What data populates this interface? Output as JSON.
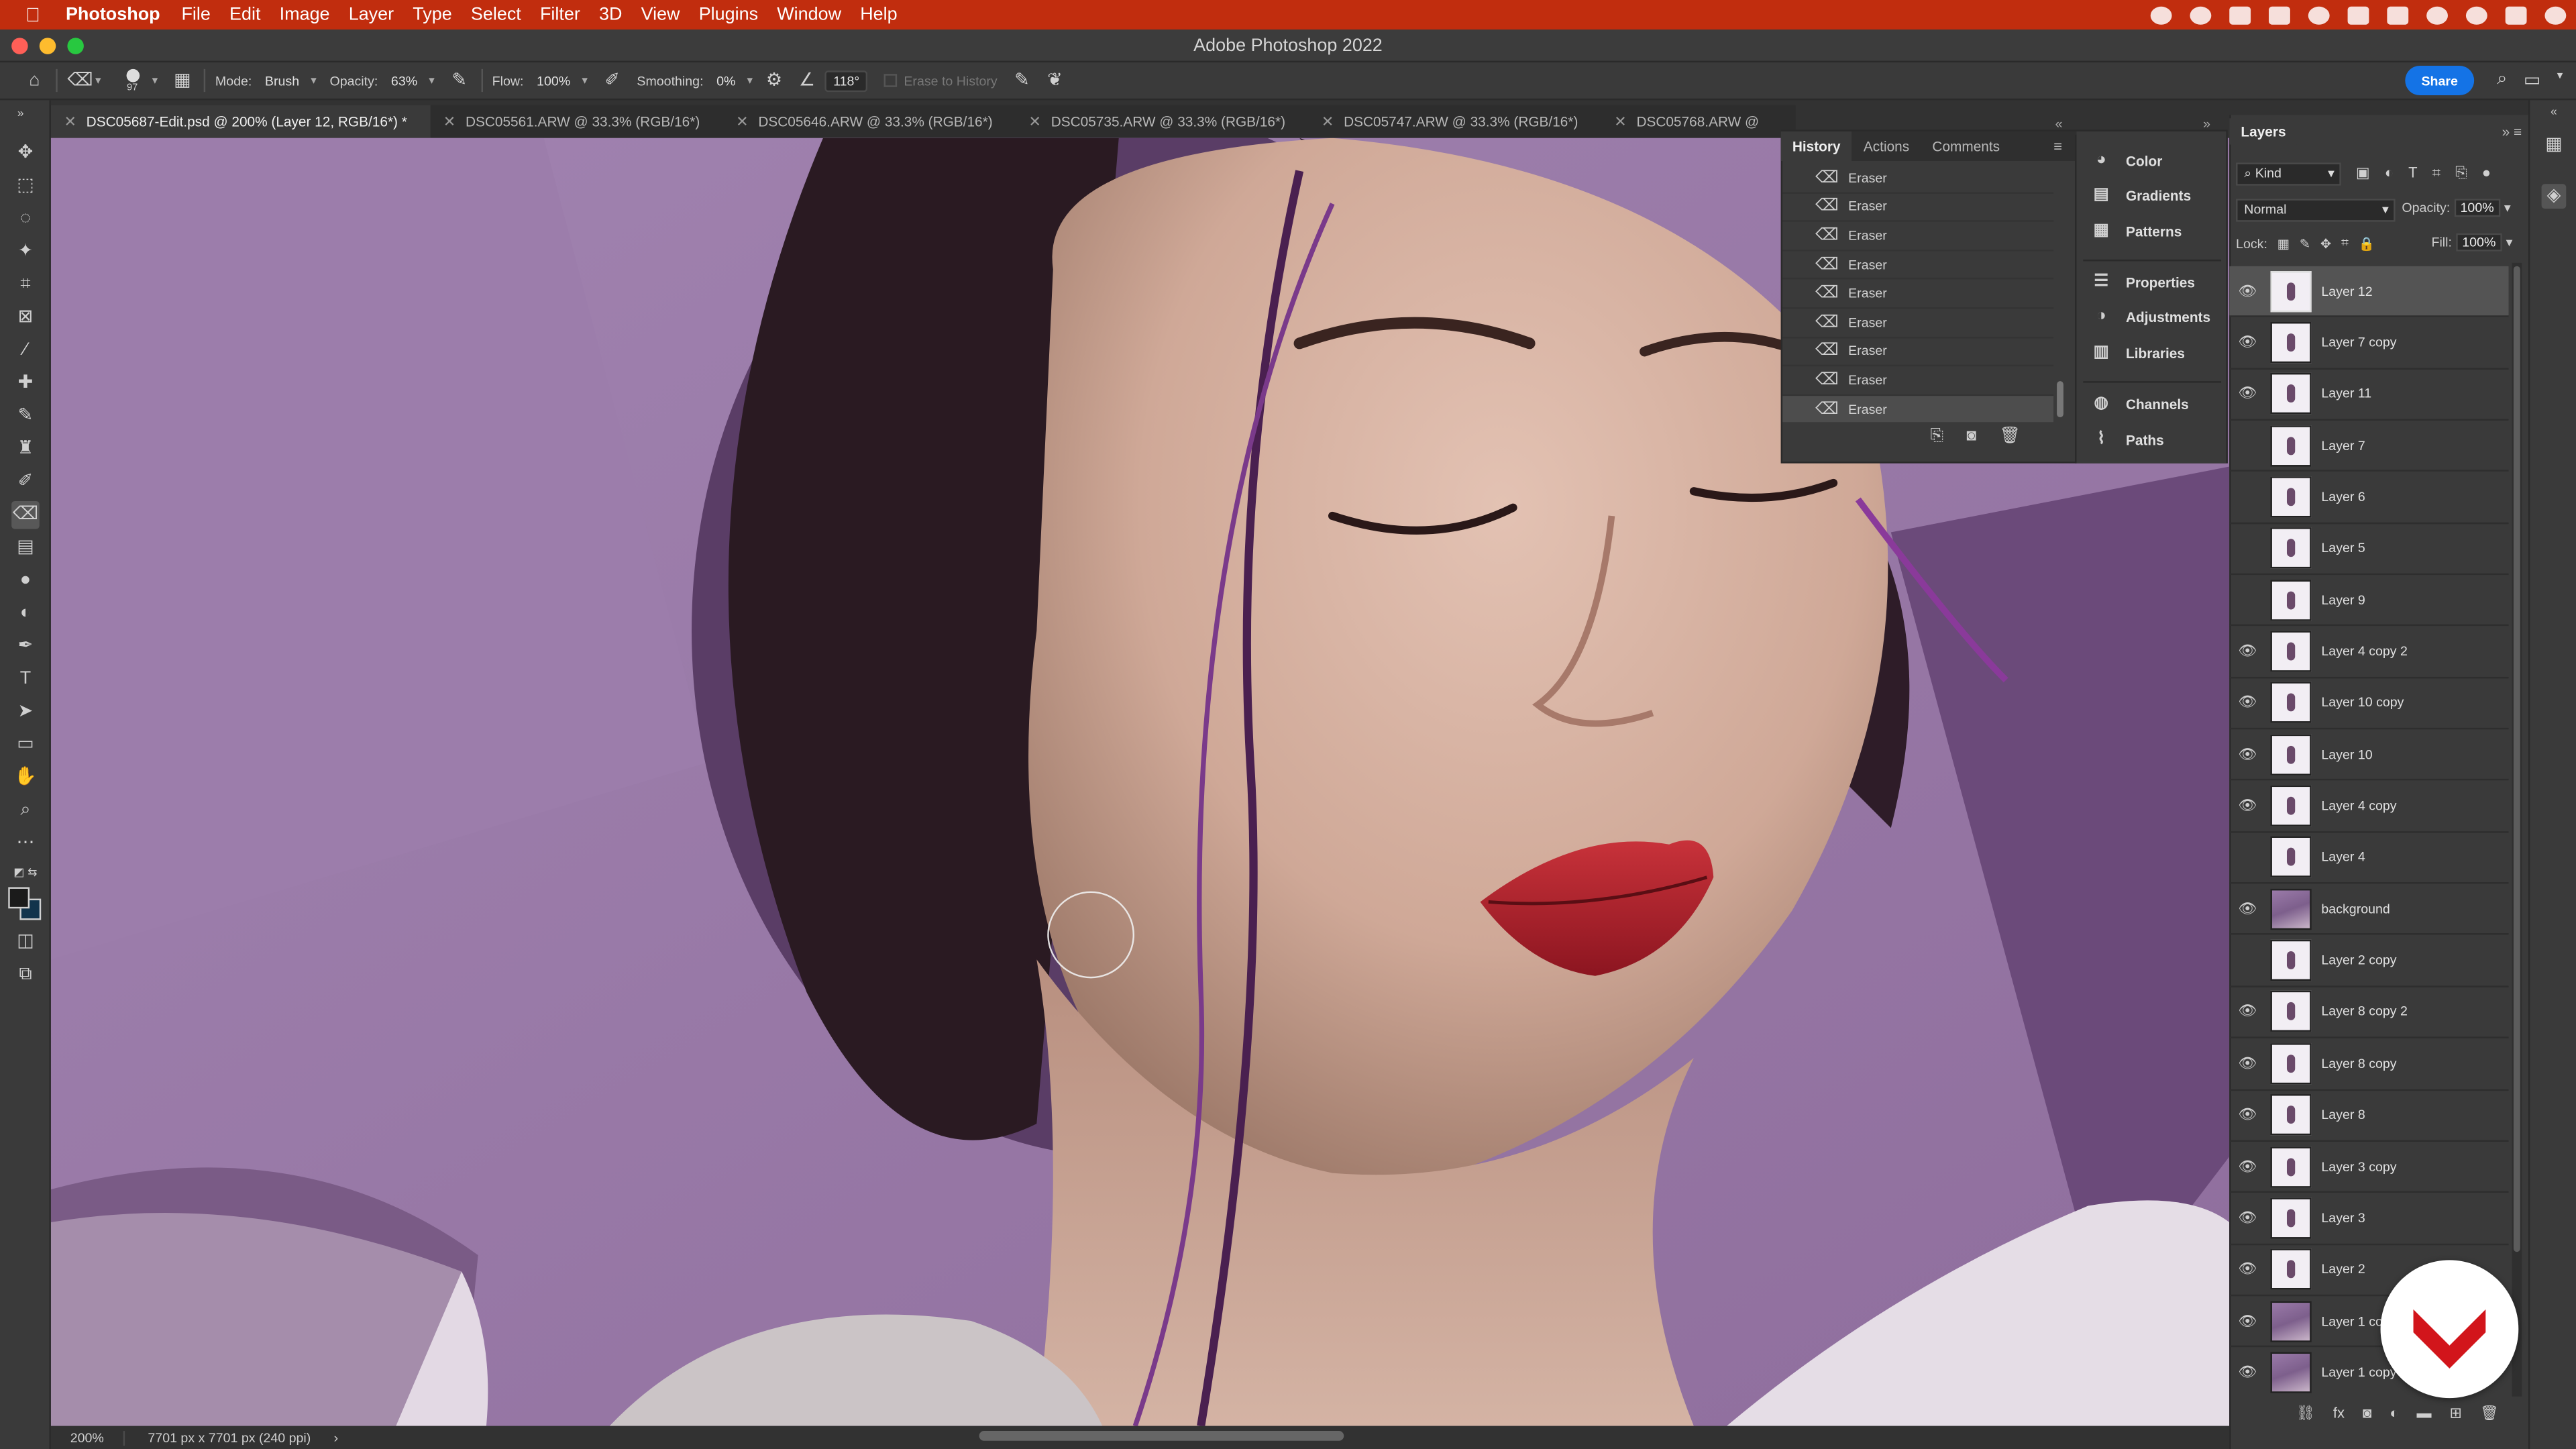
{
  "menubar": {
    "items": [
      "Photoshop",
      "File",
      "Edit",
      "Image",
      "Layer",
      "Type",
      "Select",
      "Filter",
      "3D",
      "View",
      "Plugins",
      "Window",
      "Help"
    ]
  },
  "window": {
    "title": "Adobe Photoshop 2022"
  },
  "options": {
    "brush_size": "97",
    "mode_label": "Mode:",
    "mode_value": "Brush",
    "opacity_label": "Opacity:",
    "opacity_value": "63%",
    "flow_label": "Flow:",
    "flow_value": "100%",
    "smoothing_label": "Smoothing:",
    "smoothing_value": "0%",
    "angle_value": "118°",
    "erase_to_history": "Erase to History",
    "share_label": "Share"
  },
  "tabs": [
    "DSC05687-Edit.psd @ 200% (Layer 12, RGB/16*) *",
    "DSC05561.ARW @ 33.3% (RGB/16*)",
    "DSC05646.ARW @ 33.3% (RGB/16*)",
    "DSC05735.ARW @ 33.3% (RGB/16*)",
    "DSC05747.ARW @ 33.3% (RGB/16*)",
    "DSC05768.ARW @"
  ],
  "status": {
    "zoom": "200%",
    "dimensions": "7701 px x 7701 px (240 ppi)"
  },
  "history": {
    "tabs": [
      "History",
      "Actions",
      "Comments"
    ],
    "items": [
      "Eraser",
      "Eraser",
      "Eraser",
      "Eraser",
      "Eraser",
      "Eraser",
      "Eraser",
      "Eraser",
      "Eraser"
    ],
    "active_index": 8
  },
  "side_panels": {
    "group1": [
      "Color",
      "Gradients",
      "Patterns"
    ],
    "group2": [
      "Properties",
      "Adjustments",
      "Libraries"
    ],
    "group3": [
      "Channels",
      "Paths"
    ]
  },
  "layers": {
    "title": "Layers",
    "filter_kind": "Kind",
    "blend_mode": "Normal",
    "opacity_label": "Opacity:",
    "opacity_value": "100%",
    "lock_label": "Lock:",
    "fill_label": "Fill:",
    "fill_value": "100%",
    "rows": [
      {
        "name": "Layer 12",
        "visible": true,
        "active": true,
        "photo": false
      },
      {
        "name": "Layer 7 copy",
        "visible": true,
        "active": false,
        "photo": false
      },
      {
        "name": "Layer 11",
        "visible": true,
        "active": false,
        "photo": false
      },
      {
        "name": "Layer 7",
        "visible": false,
        "active": false,
        "photo": false
      },
      {
        "name": "Layer 6",
        "visible": false,
        "active": false,
        "photo": false
      },
      {
        "name": "Layer 5",
        "visible": false,
        "active": false,
        "photo": false
      },
      {
        "name": "Layer 9",
        "visible": false,
        "active": false,
        "photo": false
      },
      {
        "name": "Layer 4 copy 2",
        "visible": true,
        "active": false,
        "photo": false
      },
      {
        "name": "Layer 10 copy",
        "visible": true,
        "active": false,
        "photo": false
      },
      {
        "name": "Layer 10",
        "visible": true,
        "active": false,
        "photo": false
      },
      {
        "name": "Layer 4 copy",
        "visible": true,
        "active": false,
        "photo": false
      },
      {
        "name": "Layer 4",
        "visible": false,
        "active": false,
        "photo": false
      },
      {
        "name": "background",
        "visible": true,
        "active": false,
        "photo": true
      },
      {
        "name": "Layer 2 copy",
        "visible": false,
        "active": false,
        "photo": false
      },
      {
        "name": "Layer 8 copy 2",
        "visible": true,
        "active": false,
        "photo": false
      },
      {
        "name": "Layer 8 copy",
        "visible": true,
        "active": false,
        "photo": false
      },
      {
        "name": "Layer 8",
        "visible": true,
        "active": false,
        "photo": false
      },
      {
        "name": "Layer 3 copy",
        "visible": true,
        "active": false,
        "photo": false
      },
      {
        "name": "Layer 3",
        "visible": true,
        "active": false,
        "photo": false
      },
      {
        "name": "Layer 2",
        "visible": true,
        "active": false,
        "photo": false
      },
      {
        "name": "Layer 1 co",
        "visible": true,
        "active": false,
        "photo": true
      },
      {
        "name": "Layer 1 copy",
        "visible": true,
        "active": false,
        "photo": true
      }
    ]
  },
  "colors": {
    "menubar": "#c12d0e",
    "accent": "#1473e6",
    "backdrop": "#9b77a8",
    "watermark": "#d2151b"
  }
}
